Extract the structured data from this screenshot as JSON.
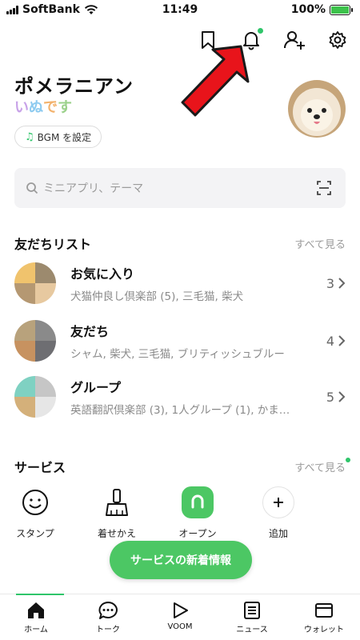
{
  "status_bar": {
    "carrier": "SoftBank",
    "time": "11:49",
    "battery": "100%"
  },
  "profile": {
    "name": "ポメラニアン",
    "status_chars": [
      "い",
      "ぬ",
      "で",
      "す"
    ],
    "bgm_label": "BGM を設定"
  },
  "search": {
    "placeholder": "ミニアプリ、テーマ"
  },
  "friends_section": {
    "title": "友だちリスト",
    "see_all": "すべて見る",
    "rows": [
      {
        "name": "お気に入り",
        "members": "犬猫仲良し倶楽部 (5), 三毛猫, 柴犬",
        "count": "3"
      },
      {
        "name": "友だち",
        "members": "シャム, 柴犬, 三毛猫, ブリティッシュブルー",
        "count": "4"
      },
      {
        "name": "グループ",
        "members": "英語翻訳倶楽部 (3), 1人グループ (1), かま…",
        "count": "5"
      }
    ]
  },
  "services_section": {
    "title": "サービス",
    "see_all": "すべて見る",
    "items": [
      {
        "label": "スタンプ"
      },
      {
        "label": "着せかえ"
      },
      {
        "label": "オープン"
      },
      {
        "label": "追加"
      }
    ]
  },
  "toast": {
    "label": "サービスの新着情報"
  },
  "tab_bar": {
    "tabs": [
      {
        "label": "ホーム"
      },
      {
        "label": "トーク"
      },
      {
        "label": "VOOM"
      },
      {
        "label": "ニュース"
      },
      {
        "label": "ウォレット"
      }
    ]
  },
  "colors": {
    "accent_green": "#4cc764",
    "arrow_red": "#e8141b"
  }
}
